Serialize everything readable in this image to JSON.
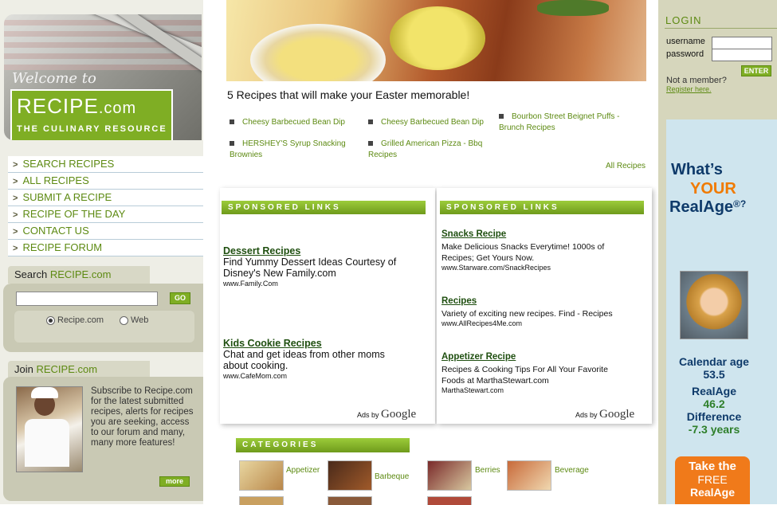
{
  "left": {
    "welcome": "Welcome to",
    "brand_main": "RECIPE",
    "brand_suffix": ".com",
    "tagline": "THE CULINARY RESOURCE",
    "nav": [
      {
        "label": "SEARCH RECIPES"
      },
      {
        "label": "ALL RECIPES"
      },
      {
        "label": "SUBMIT A RECIPE"
      },
      {
        "label": "RECIPE OF THE DAY"
      },
      {
        "label": "CONTACT US"
      },
      {
        "label": "RECIPE  FORUM"
      }
    ],
    "search": {
      "head_prefix": "Search",
      "head_brand": "RECIPE.com",
      "input_value": "",
      "go_label": "GO",
      "options": [
        "Recipe.com",
        "Web"
      ],
      "selected": "Recipe.com"
    },
    "join": {
      "head_prefix": "Join",
      "head_brand": "RECIPE.com",
      "text": "Subscribe to Recipe.com for the latest submitted recipes, alerts for recipes you are seeking, access to our forum and many, many more features!",
      "more_label": "more"
    }
  },
  "main": {
    "headline": "5 Recipes that will make your Easter memorable!",
    "easter_links": [
      "Cheesy Barbecued Bean Dip",
      "Cheesy Barbecued Bean Dip",
      "Bourbon Street Beignet Puffs - Brunch Recipes",
      "HERSHEY'S Syrup Snacking Brownies",
      "Grilled American Pizza - Bbq Recipes"
    ],
    "all_recipes": "All Recipes",
    "sponsored_head": "SPONSORED LINKS",
    "ads_left": [
      {
        "title": "Dessert Recipes",
        "body": "Find Yummy Dessert Ideas Courtesy of Disney's New Family.com",
        "url": "www.Family.Com"
      },
      {
        "title": "Kids Cookie Recipes",
        "body": "Chat and get ideas from other moms about cooking.",
        "url": "www.CafeMom.com"
      }
    ],
    "ads_right": [
      {
        "title": "Snacks Recipe",
        "body": "Make Delicious Snacks Everytime! 1000s of Recipes; Get Yours Now.",
        "url": "www.Starware.com/SnackRecipes"
      },
      {
        "title": "Recipes",
        "body": "Variety of exciting new recipes. Find - Recipes",
        "url": "www.AllRecipes4Me.com"
      },
      {
        "title": "Appetizer Recipe",
        "body": "Recipes & Cooking Tips For All Your Favorite Foods at MarthaStewart.com",
        "url": "MarthaStewart.com"
      }
    ],
    "ads_by": "Ads by",
    "google": "Google",
    "categories_head": "CATEGORIES",
    "categories": [
      "Appetizer",
      "Barbeque",
      "Berries",
      "Beverage"
    ]
  },
  "right": {
    "login_title": "LOGIN",
    "username_label": "username",
    "password_label": "password",
    "username_value": "",
    "password_value": "",
    "enter_label": "ENTER",
    "not_member": "Not a member?",
    "register": "Register here.",
    "realage": {
      "whats": "What’s",
      "your": "YOUR",
      "name": "RealAge",
      "reg": "®?",
      "calendar_label": "Calendar age",
      "calendar_value": "53.5",
      "realage_label": "RealAge",
      "realage_value": "46.2",
      "diff_label": "Difference",
      "diff_value": "-7.3 years",
      "btn_line1": "Take the",
      "btn_line2": "FREE",
      "btn_line3": "RealAge"
    }
  },
  "colors": {
    "accent_green": "#7fae24",
    "link_green": "#5d8a12",
    "realage_blue": "#0e3a6a",
    "realage_orange": "#f07a00"
  }
}
